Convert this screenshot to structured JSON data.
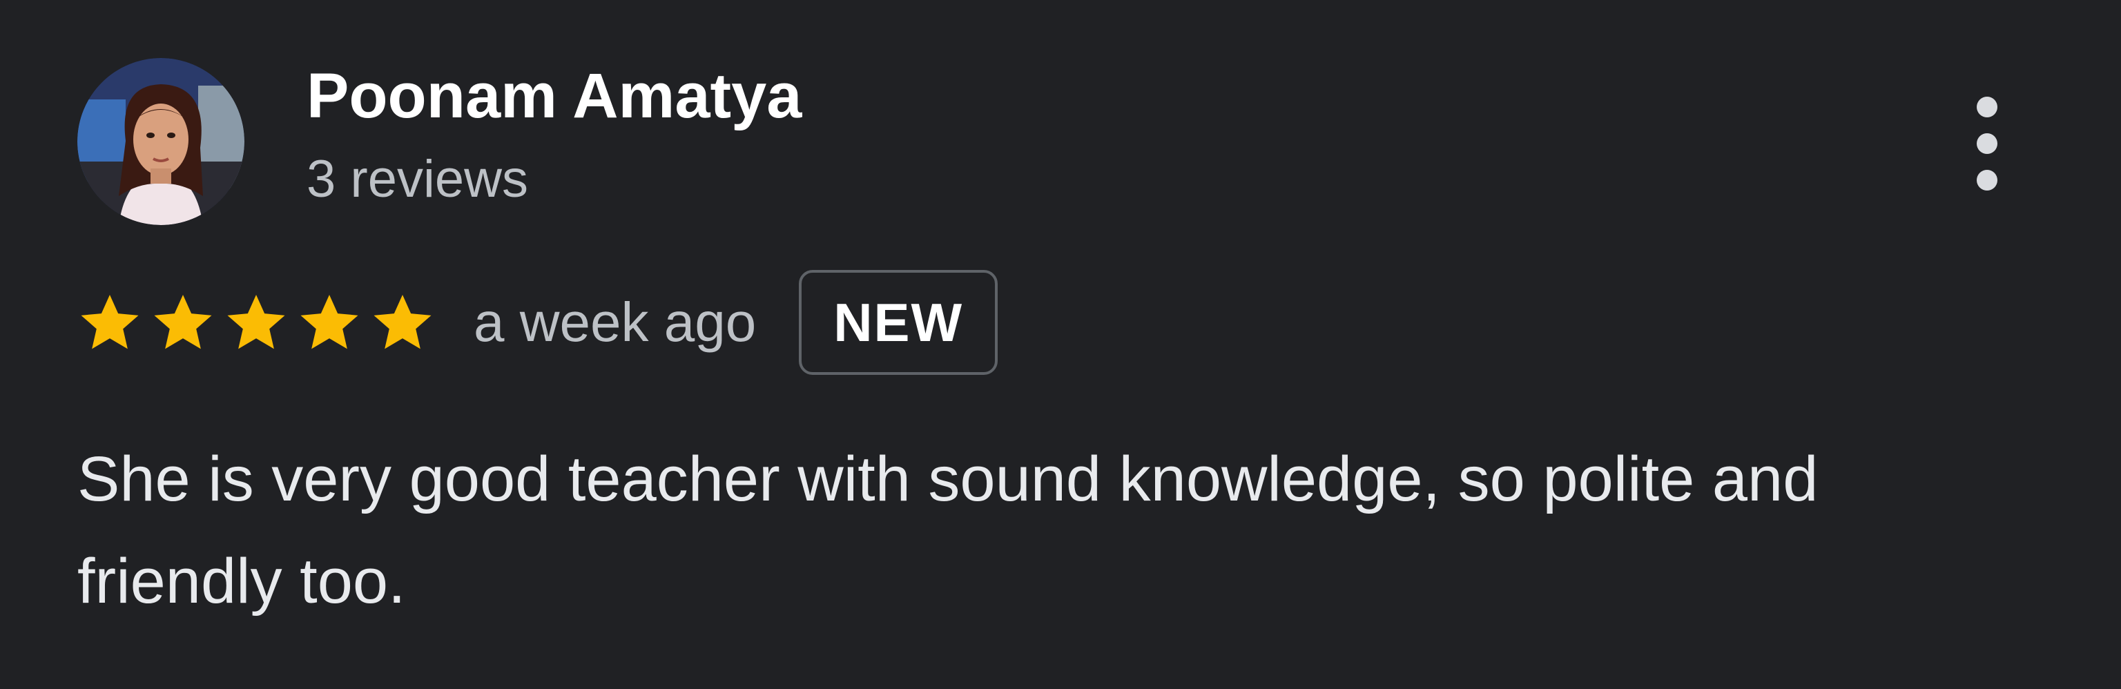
{
  "review": {
    "reviewer_name": "Poonam Amatya",
    "review_count": "3 reviews",
    "rating": 5,
    "rating_max": 5,
    "date": "a week ago",
    "badge": "NEW",
    "text": "She is very good teacher with sound knowledge, so polite and friendly too."
  },
  "icons": {
    "avatar": "profile-photo",
    "more": "more-vert-icon",
    "star": "star-icon"
  },
  "colors": {
    "background": "#202124",
    "star": "#fbbc04",
    "name": "#ffffff",
    "secondary_text": "#bdc1c6",
    "badge_border": "#5f6368"
  }
}
